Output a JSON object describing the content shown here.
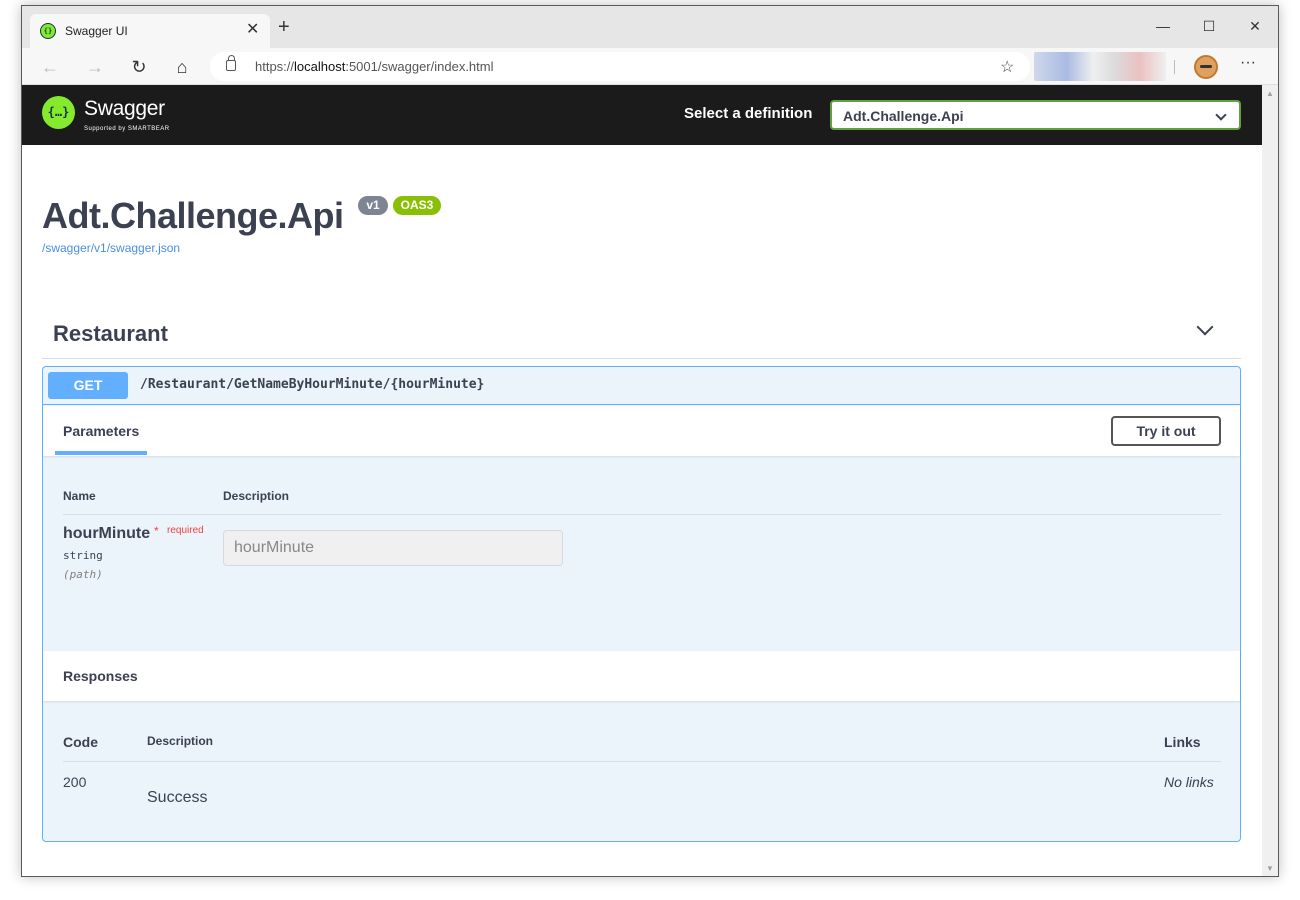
{
  "browser": {
    "tab_title": "Swagger UI",
    "tab_close": "✕",
    "new_tab": "+",
    "minimize": "—",
    "maximize": "☐",
    "close": "✕",
    "url_prefix": "https://",
    "url_host": "localhost",
    "url_rest": ":5001/swagger/index.html",
    "more": "···"
  },
  "topbar": {
    "logo_glyph": "{…}",
    "logo_text": "Swagger",
    "logo_sub": "Supported by SMARTBEAR",
    "select_label": "Select a definition",
    "select_value": "Adt.Challenge.Api"
  },
  "info": {
    "title": "Adt.Challenge.Api",
    "version_badge": "v1",
    "oas_badge": "OAS3",
    "spec_link": "/swagger/v1/swagger.json"
  },
  "tag": {
    "name": "Restaurant"
  },
  "operation": {
    "method": "GET",
    "path": "/Restaurant/GetNameByHourMinute/{hourMinute}",
    "parameters_label": "Parameters",
    "try_label": "Try it out",
    "col_name": "Name",
    "col_description": "Description",
    "param": {
      "name": "hourMinute",
      "required_star": "*",
      "required_label": "required",
      "type": "string",
      "in": "(path)",
      "placeholder": "hourMinute"
    },
    "responses_label": "Responses",
    "resp_col_code": "Code",
    "resp_col_description": "Description",
    "resp_col_links": "Links",
    "response": {
      "code": "200",
      "description": "Success",
      "links": "No links"
    }
  },
  "colors": {
    "swagger_green": "#85ea2d",
    "get_blue": "#61affe",
    "topbar_bg": "#1b1b1b",
    "oas_green": "#89bf04"
  }
}
